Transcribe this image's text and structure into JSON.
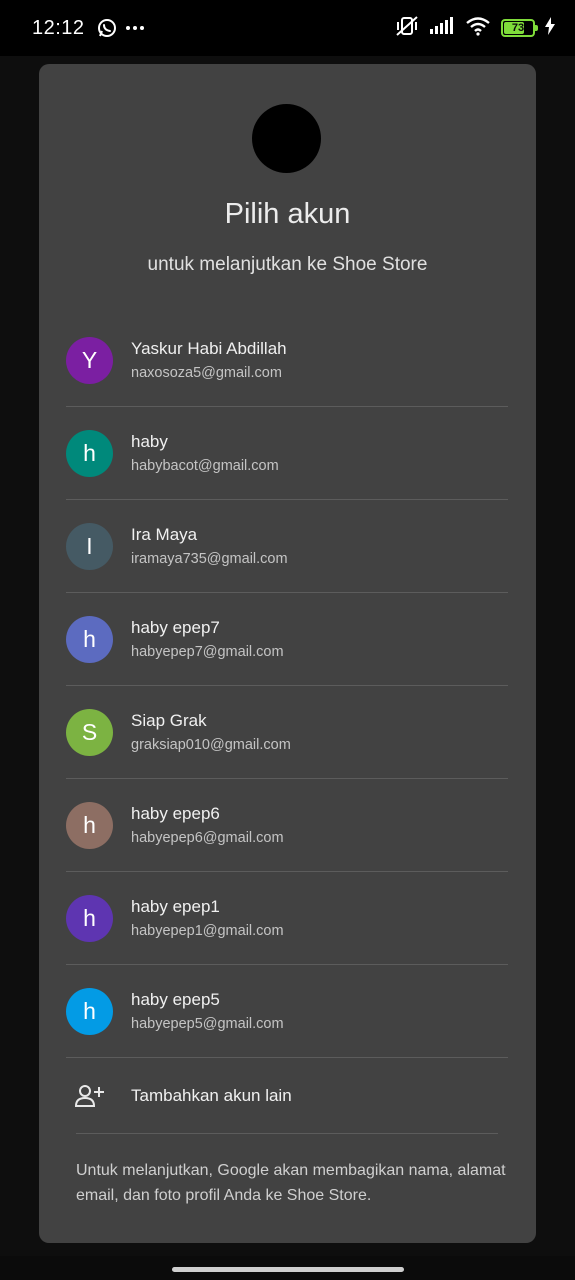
{
  "status_bar": {
    "time": "12:12",
    "battery_level": "73",
    "battery_percent": 73,
    "icons": [
      "whatsapp-icon",
      "more-dots-icon",
      "vibrate-off-icon",
      "signal-icon",
      "wifi-icon",
      "battery-icon",
      "charging-bolt-icon"
    ]
  },
  "dialog": {
    "title": "Pilih akun",
    "subtitle": "untuk melanjutkan ke Shoe Store",
    "accounts": [
      {
        "initial": "Y",
        "name": "Yaskur Habi Abdillah",
        "email": "naxosoza5@gmail.com",
        "color": "#7b1fa2"
      },
      {
        "initial": "h",
        "name": "haby",
        "email": "habybacot@gmail.com",
        "color": "#00897b"
      },
      {
        "initial": "I",
        "name": "Ira Maya",
        "email": "iramaya735@gmail.com",
        "color": "#455a64"
      },
      {
        "initial": "h",
        "name": "haby epep7",
        "email": "habyepep7@gmail.com",
        "color": "#5c6bc0"
      },
      {
        "initial": "S",
        "name": "Siap Grak",
        "email": "graksiap010@gmail.com",
        "color": "#7cb342"
      },
      {
        "initial": "h",
        "name": "haby epep6",
        "email": "habyepep6@gmail.com",
        "color": "#8d6e63"
      },
      {
        "initial": "h",
        "name": "haby epep1",
        "email": "habyepep1@gmail.com",
        "color": "#5e35b1"
      },
      {
        "initial": "h",
        "name": "haby epep5",
        "email": "habyepep5@gmail.com",
        "color": "#039be5"
      }
    ],
    "add_account_label": "Tambahkan akun lain",
    "footer": "Untuk melanjutkan, Google akan membagikan nama, alamat email, dan foto profil Anda ke Shoe Store."
  }
}
